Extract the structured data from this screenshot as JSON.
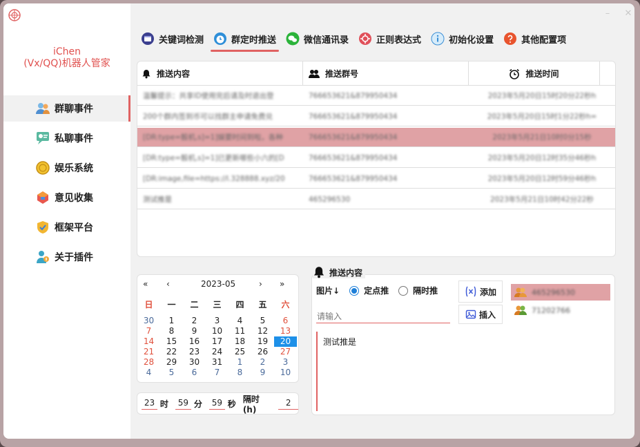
{
  "app": {
    "brand_line1": "iChen",
    "brand_line2": "(Vx/QQ)机器人管家"
  },
  "sidebar": {
    "items": [
      {
        "label": "群聊事件"
      },
      {
        "label": "私聊事件"
      },
      {
        "label": "娱乐系统"
      },
      {
        "label": "意见收集"
      },
      {
        "label": "框架平台"
      },
      {
        "label": "关于插件"
      }
    ]
  },
  "tabs": [
    {
      "label": "关键词检测"
    },
    {
      "label": "群定时推送"
    },
    {
      "label": "微信通讯录"
    },
    {
      "label": "正则表达式"
    },
    {
      "label": "初始化设置"
    },
    {
      "label": "其他配置项"
    }
  ],
  "table": {
    "headers": [
      "推送内容",
      "推送群号",
      "推送时间"
    ],
    "rows": [
      {
        "content": "温馨提示：共享ID使用完后请及时退出登",
        "group": "766653621&879950434",
        "time": "2023年5月20日15时20分22秒h"
      },
      {
        "content": "200个群内签到币可以找群主申请免费兑",
        "group": "766653621&879950434",
        "time": "2023年5月20日15时1分22秒h="
      },
      {
        "content": "[DR:type=骰机,s]=1]娱要时间到啦，各种",
        "group": "766653621&879950434",
        "time": "2023年5月21日10时0分15秒"
      },
      {
        "content": "[DR:type=骰机,s]=1]已更新哪些小六的[D",
        "group": "766653621&879950434",
        "time": "2023年5月20日12时35分46秒h"
      },
      {
        "content": "[DR:image,file=https://l.328888.xyz/20",
        "group": "766653621&879950434",
        "time": "2023年5月20日12时59分46秒h"
      },
      {
        "content": "测试推是",
        "group": "465296530",
        "time": "2023年5月21日10时42分22秒"
      }
    ]
  },
  "calendar": {
    "month": "2023-05",
    "weekdays": [
      "日",
      "一",
      "二",
      "三",
      "四",
      "五",
      "六"
    ],
    "weeks": [
      [
        "30",
        "1",
        "2",
        "3",
        "4",
        "5",
        "6"
      ],
      [
        "7",
        "8",
        "9",
        "10",
        "11",
        "12",
        "13"
      ],
      [
        "14",
        "15",
        "16",
        "17",
        "18",
        "19",
        "20"
      ],
      [
        "21",
        "22",
        "23",
        "24",
        "25",
        "26",
        "27"
      ],
      [
        "28",
        "29",
        "30",
        "31",
        "1",
        "2",
        "3"
      ],
      [
        "4",
        "5",
        "6",
        "7",
        "8",
        "9",
        "10"
      ]
    ],
    "selected_day": "20"
  },
  "time": {
    "hour": "23",
    "hour_label": "时",
    "minute": "59",
    "minute_label": "分",
    "second": "59",
    "second_label": "秒",
    "interval_label": "隔时(h)",
    "interval": "2"
  },
  "push": {
    "label": "推送内容",
    "type_label": "图片↓",
    "opt_fixed": "定点推",
    "opt_interval": "隔时推",
    "input_placeholder": "请输入",
    "add_label": "添加",
    "insert_label": "插入",
    "text": "测试推是",
    "groups": [
      "465296530",
      "71202766"
    ]
  },
  "colors": {
    "accent": "#e06262",
    "selected_row": "#e0a2a5",
    "today": "#1e90e8"
  }
}
